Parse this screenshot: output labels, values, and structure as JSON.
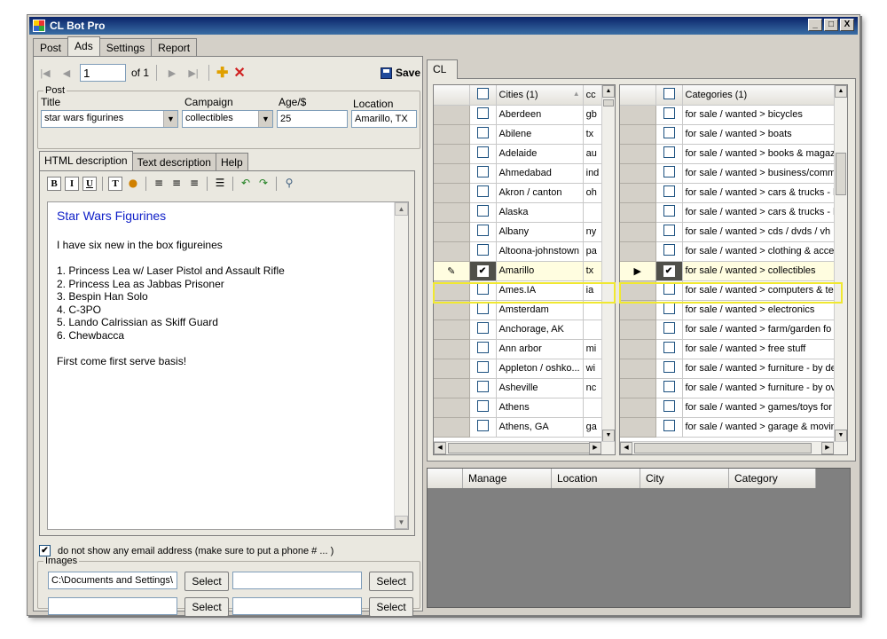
{
  "window": {
    "title": "CL Bot Pro",
    "controls": [
      "_",
      "□",
      "X"
    ]
  },
  "main_tabs": [
    "Post",
    "Ads",
    "Settings",
    "Report"
  ],
  "active_main_tab": "Ads",
  "nav": {
    "page_value": "1",
    "of_label": "of 1",
    "save_label": "Save"
  },
  "post": {
    "legend": "Post",
    "title_label": "Title",
    "title_value": "star wars figurines",
    "campaign_label": "Campaign",
    "campaign_value": "collectibles",
    "age_label": "Age/$",
    "age_value": "25",
    "location_label": "Location",
    "location_value": "Amarillo, TX"
  },
  "desc_tabs": [
    "HTML description",
    "Text description",
    "Help"
  ],
  "editor": {
    "heading": "Star Wars Figurines",
    "intro": "I have six new in the box figureines",
    "items": [
      "1. Princess Lea w/ Laser Pistol and Assault Rifle",
      "2. Princess Lea as Jabbas Prisoner",
      "3. Bespin Han Solo",
      "4. C-3PO",
      "5. Lando Calrissian as Skiff Guard",
      "6. Chewbacca"
    ],
    "closing": "First come first serve basis!"
  },
  "email_option": {
    "checked": true,
    "label": "do not show any email address (make sure to put a phone # ... )"
  },
  "images": {
    "legend": "Images",
    "paths": [
      "C:\\Documents and Settings\\",
      "",
      "",
      ""
    ],
    "select_label": "Select"
  },
  "cl_tab": "CL",
  "cities": {
    "header_city": "Cities (1)",
    "header_code": "cc",
    "rows": [
      {
        "city": "Aberdeen",
        "code": "gb",
        "checked": false
      },
      {
        "city": "Abilene",
        "code": "tx",
        "checked": false
      },
      {
        "city": "Adelaide",
        "code": "au",
        "checked": false
      },
      {
        "city": "Ahmedabad",
        "code": "ind",
        "checked": false
      },
      {
        "city": "Akron / canton",
        "code": "oh",
        "checked": false
      },
      {
        "city": "Alaska",
        "code": "",
        "checked": false
      },
      {
        "city": "Albany",
        "code": "ny",
        "checked": false
      },
      {
        "city": "Altoona-johnstown",
        "code": "pa",
        "checked": false
      },
      {
        "city": "Amarillo",
        "code": "tx",
        "checked": true,
        "selected": true
      },
      {
        "city": "Ames.IA",
        "code": "ia",
        "checked": false
      },
      {
        "city": "Amsterdam",
        "code": "",
        "checked": false
      },
      {
        "city": "Anchorage, AK",
        "code": "",
        "checked": false
      },
      {
        "city": "Ann arbor",
        "code": "mi",
        "checked": false
      },
      {
        "city": "Appleton / oshko...",
        "code": "wi",
        "checked": false
      },
      {
        "city": "Asheville",
        "code": "nc",
        "checked": false
      },
      {
        "city": "Athens",
        "code": "",
        "checked": false
      },
      {
        "city": "Athens, GA",
        "code": "ga",
        "checked": false
      }
    ]
  },
  "categories": {
    "header": "Categories (1)",
    "rows": [
      {
        "name": "for sale / wanted > bicycles",
        "checked": false
      },
      {
        "name": "for sale / wanted > boats",
        "checked": false
      },
      {
        "name": "for sale / wanted > books & magaz",
        "checked": false
      },
      {
        "name": "for sale / wanted > business/comm",
        "checked": false
      },
      {
        "name": "for sale / wanted > cars & trucks - l",
        "checked": false
      },
      {
        "name": "for sale / wanted > cars & trucks - l",
        "checked": false
      },
      {
        "name": "for sale / wanted > cds / dvds / vh",
        "checked": false
      },
      {
        "name": "for sale / wanted > clothing & acce",
        "checked": false
      },
      {
        "name": "for sale / wanted > collectibles",
        "checked": true,
        "selected": true
      },
      {
        "name": "for sale / wanted > computers & te",
        "checked": false
      },
      {
        "name": "for sale / wanted > electronics",
        "checked": false
      },
      {
        "name": "for sale / wanted > farm/garden fo",
        "checked": false
      },
      {
        "name": "for sale / wanted > free stuff",
        "checked": false
      },
      {
        "name": "for sale / wanted > furniture - by de",
        "checked": false
      },
      {
        "name": "for sale / wanted > furniture - by ov",
        "checked": false
      },
      {
        "name": "for sale / wanted > games/toys for",
        "checked": false
      },
      {
        "name": "for sale / wanted > garage & movin",
        "checked": false
      }
    ]
  },
  "manage_grid": {
    "columns": [
      "Manage",
      "Location",
      "City",
      "Category"
    ]
  }
}
